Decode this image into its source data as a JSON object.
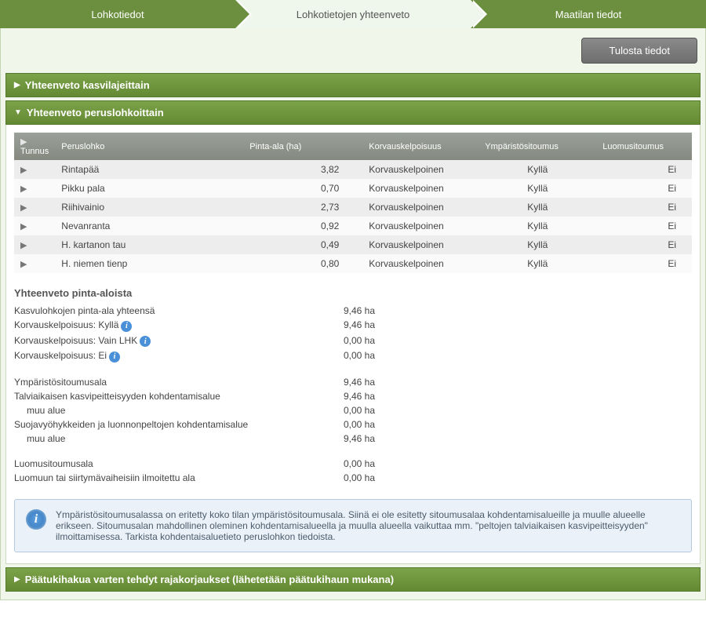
{
  "wizard": {
    "step1": "Lohkotiedot",
    "step2": "Lohkotietojen yhteenveto",
    "step3": "Maatilan tiedot"
  },
  "buttons": {
    "print": "Tulosta tiedot"
  },
  "panels": {
    "byPlant": "Yhteenveto kasvilajeittain",
    "byParcel": "Yhteenveto peruslohkoittain",
    "corrections": "Päätukihakua varten tehdyt rajakorjaukset (lähetetään päätukihaun mukana)"
  },
  "table": {
    "headers": {
      "tunnus": "Tunnus",
      "peruslohko": "Peruslohko",
      "ala": "Pinta-ala (ha)",
      "kelp": "Korvauskelpoisuus",
      "ymp": "Ympäristösitoumus",
      "luomu": "Luomusitoumus"
    },
    "rows": [
      {
        "name": "Rintapää",
        "area": "3,82",
        "kelp": "Korvauskelpoinen",
        "ymp": "Kyllä",
        "luomu": "Ei"
      },
      {
        "name": "Pikku pala",
        "area": "0,70",
        "kelp": "Korvauskelpoinen",
        "ymp": "Kyllä",
        "luomu": "Ei"
      },
      {
        "name": "Riihivainio",
        "area": "2,73",
        "kelp": "Korvauskelpoinen",
        "ymp": "Kyllä",
        "luomu": "Ei"
      },
      {
        "name": "Nevanranta",
        "area": "0,92",
        "kelp": "Korvauskelpoinen",
        "ymp": "Kyllä",
        "luomu": "Ei"
      },
      {
        "name": "H. kartanon tau",
        "area": "0,49",
        "kelp": "Korvauskelpoinen",
        "ymp": "Kyllä",
        "luomu": "Ei"
      },
      {
        "name": "H. niemen tienp",
        "area": "0,80",
        "kelp": "Korvauskelpoinen",
        "ymp": "Kyllä",
        "luomu": "Ei"
      }
    ]
  },
  "summary": {
    "title": "Yhteenveto pinta-aloista",
    "rows": {
      "r1": {
        "label": "Kasvulohkojen pinta-ala yhteensä",
        "value": "9,46 ha"
      },
      "r2": {
        "label": "Korvauskelpoisuus: Kyllä",
        "value": "9,46 ha",
        "info": true
      },
      "r3": {
        "label": "Korvauskelpoisuus: Vain LHK",
        "value": "0,00 ha",
        "info": true
      },
      "r4": {
        "label": "Korvauskelpoisuus: Ei",
        "value": "0,00 ha",
        "info": true
      },
      "r5": {
        "label": "Ympäristösitoumusala",
        "value": "9,46 ha"
      },
      "r6": {
        "label": "Talviaikaisen kasvipeitteisyyden kohdentamisalue",
        "value": "9,46 ha"
      },
      "r7": {
        "label": "muu alue",
        "value": "0,00 ha"
      },
      "r8": {
        "label": "Suojavyöhykkeiden ja luonnonpeltojen kohdentamisalue",
        "value": "0,00 ha"
      },
      "r9": {
        "label": "muu alue",
        "value": "9,46 ha"
      },
      "r10": {
        "label": "Luomusitoumusala",
        "value": "0,00 ha"
      },
      "r11": {
        "label": "Luomuun tai siirtymävaiheisiin ilmoitettu ala",
        "value": "0,00 ha"
      }
    }
  },
  "notice": "Ympäristösitoumusalassa on eritetty koko tilan ympäristösitoumusala. Siinä ei ole esitetty sitoumusalaa kohdentamisalueille ja muulle alueelle erikseen. Sitoumusalan mahdollinen oleminen kohdentamisalueella ja muulla alueella vaikuttaa mm. \"peltojen talviaikaisen kasvipeitteisyyden\" ilmoittamisessa. Tarkista kohdentaisaluetieto peruslohkon tiedoista."
}
